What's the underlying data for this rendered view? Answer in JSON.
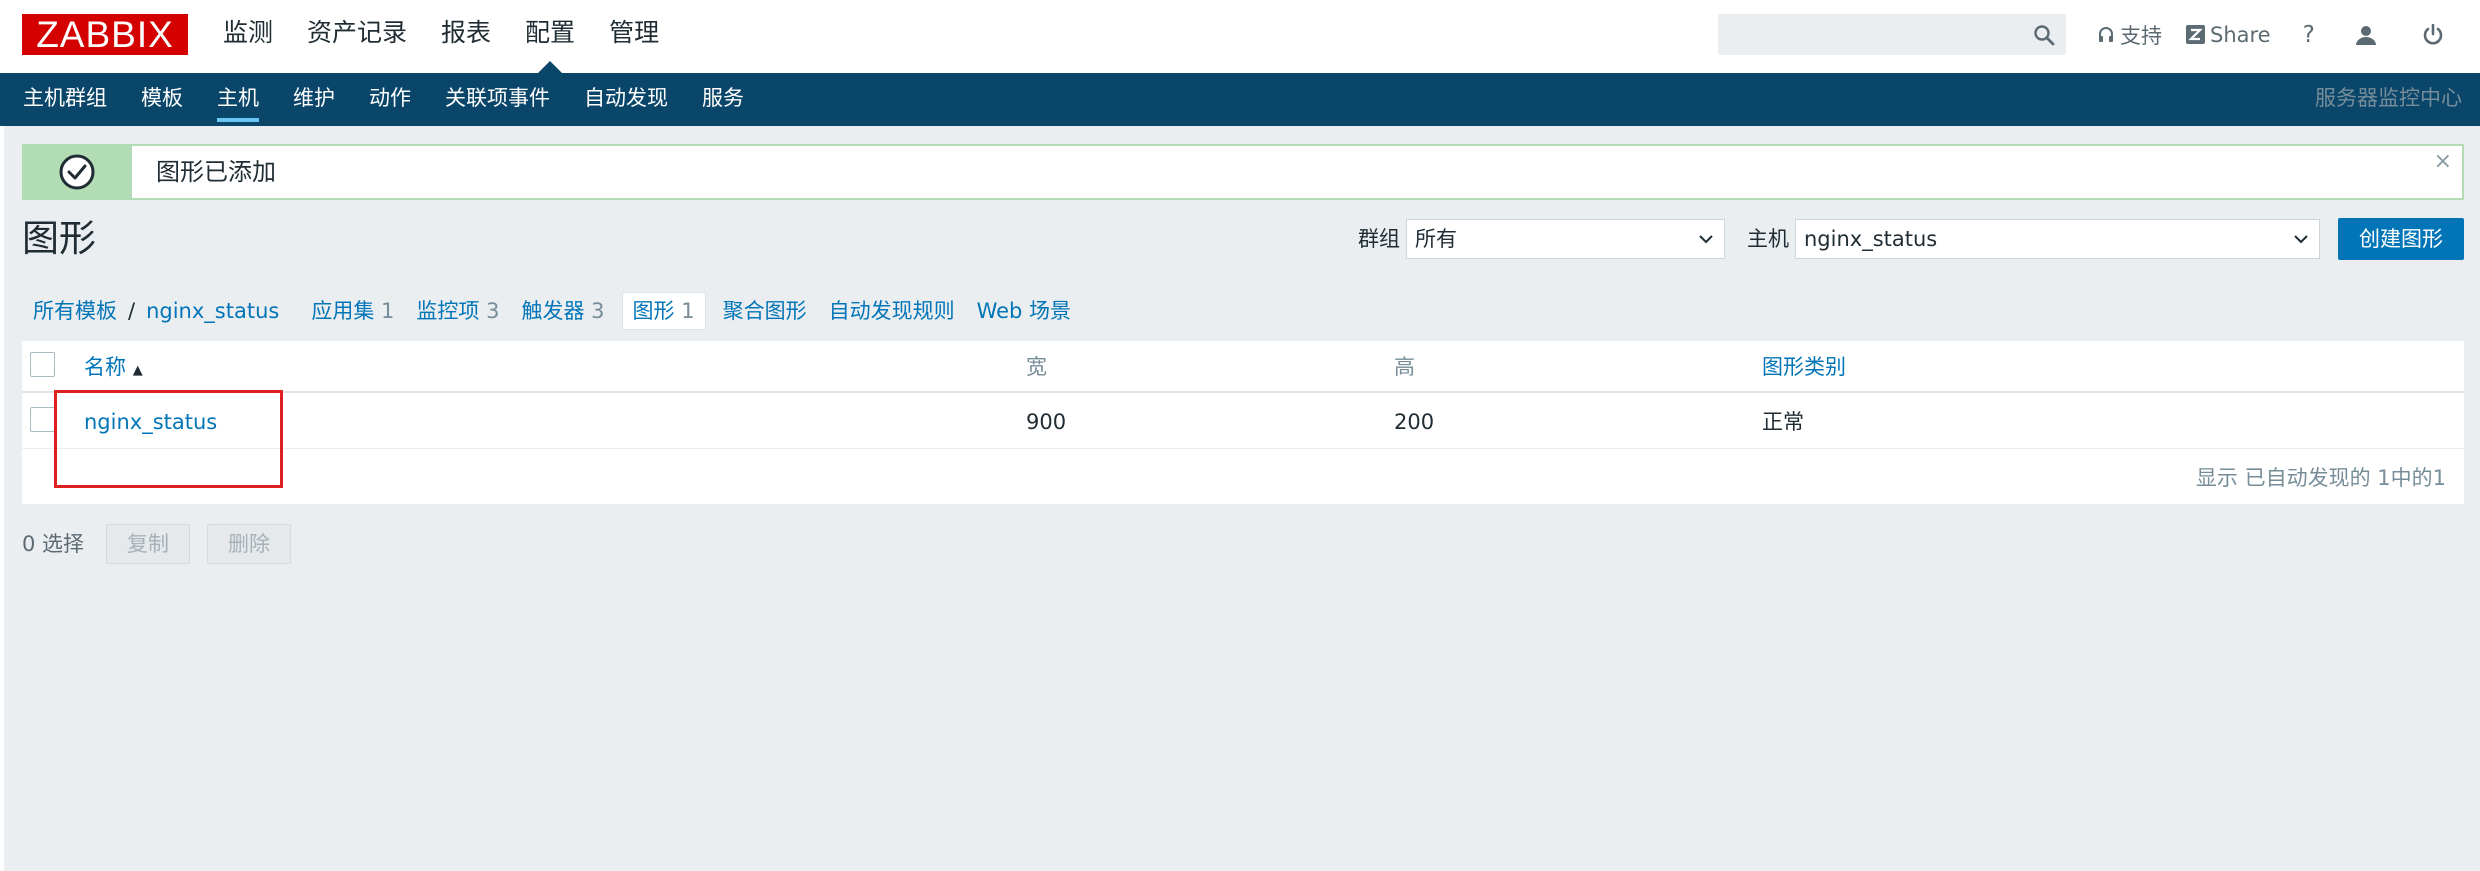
{
  "header": {
    "logo": "ZABBIX",
    "nav": [
      "监测",
      "资产记录",
      "报表",
      "配置",
      "管理"
    ],
    "active_nav": "配置",
    "search": {
      "value": "",
      "placeholder": ""
    },
    "support_label": "支持",
    "share_label": "Share",
    "help_label": "?"
  },
  "subnav": {
    "items": [
      "主机群组",
      "模板",
      "主机",
      "维护",
      "动作",
      "关联项事件",
      "自动发现",
      "服务"
    ],
    "active": "主机",
    "server_name": "服务器监控中心"
  },
  "message": {
    "text": "图形已添加",
    "close": "×"
  },
  "page": {
    "title": "图形",
    "group_label": "群组",
    "group_value": "所有",
    "host_label": "主机",
    "host_value": "nginx_status",
    "create_button": "创建图形"
  },
  "breadcrumb": {
    "all_templates": "所有模板",
    "separator": "/",
    "host": "nginx_status",
    "tabs": [
      {
        "label": "应用集",
        "count": "1"
      },
      {
        "label": "监控项",
        "count": "3"
      },
      {
        "label": "触发器",
        "count": "3"
      },
      {
        "label": "图形",
        "count": "1"
      },
      {
        "label": "聚合图形",
        "count": ""
      },
      {
        "label": "自动发现规则",
        "count": ""
      },
      {
        "label": "Web 场景",
        "count": ""
      }
    ]
  },
  "table": {
    "columns": [
      "名称",
      "宽",
      "高",
      "图形类别"
    ],
    "sort_indicator": "▲",
    "rows": [
      {
        "name": "nginx_status",
        "width": "900",
        "height": "200",
        "type": "正常"
      }
    ],
    "footer": "显示 已自动发现的 1中的1"
  },
  "actions": {
    "selected": "0 选择",
    "copy": "复制",
    "delete": "删除"
  },
  "colors": {
    "brand_red": "#d40000",
    "subnav_bg": "#0a466a",
    "link": "#0275b8",
    "success": "#b2dcb3",
    "highlight": "#e02020"
  }
}
